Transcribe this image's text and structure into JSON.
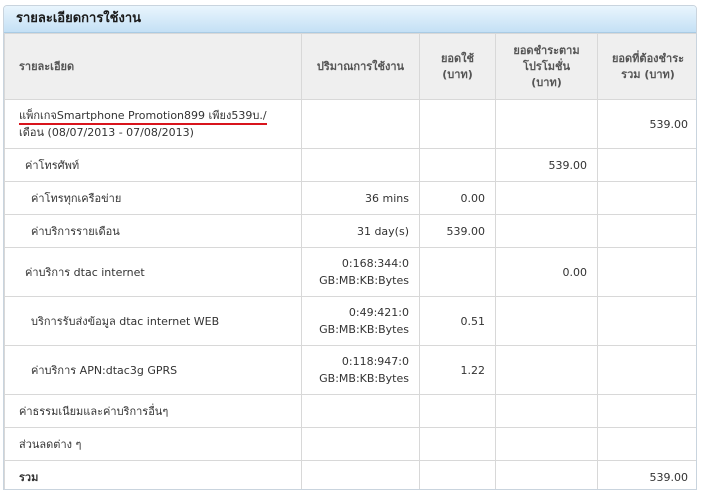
{
  "panel": {
    "title": "รายละเอียดการใช้งาน"
  },
  "columns": {
    "detail": "รายละเอียด",
    "usage": "ปริมาณการใช้งาน",
    "charge": "ยอดใช้ (บาท)",
    "promo": "ยอดชำระตามโปรโมชั่น (บาท)",
    "total": "ยอดที่ต้องชำระรวม (บาท)"
  },
  "rows": {
    "package": {
      "name": "แพ็กเกจSmartphone Promotion899 เพียง539บ./",
      "period": "เดือน (08/07/2013 - 07/08/2013)",
      "total": "539.00"
    },
    "call": {
      "label": "ค่าโทรศัพท์",
      "promo": "539.00"
    },
    "call_all": {
      "label": "ค่าโทรทุกเครือข่าย",
      "usage": "36 mins",
      "charge": "0.00"
    },
    "monthly": {
      "label": "ค่าบริการรายเดือน",
      "usage": "31 day(s)",
      "charge": "539.00"
    },
    "internet": {
      "label": "ค่าบริการ dtac internet",
      "usage1": "0:168:344:0",
      "usage2": "GB:MB:KB:Bytes",
      "promo": "0.00"
    },
    "web": {
      "label": "บริการรับส่งข้อมูล dtac internet WEB",
      "usage1": "0:49:421:0",
      "usage2": "GB:MB:KB:Bytes",
      "charge": "0.51"
    },
    "apn": {
      "label": "ค่าบริการ APN:dtac3g GPRS",
      "usage1": "0:118:947:0",
      "usage2": "GB:MB:KB:Bytes",
      "charge": "1.22"
    },
    "fees": {
      "label": "ค่าธรรมเนียมและค่าบริการอื่นๆ"
    },
    "discounts": {
      "label": "ส่วนลดต่าง ๆ"
    },
    "sum": {
      "label": "รวม",
      "total": "539.00"
    }
  },
  "colors": {
    "header_bg": "#c4e0f5",
    "underline": "#d8141c"
  }
}
